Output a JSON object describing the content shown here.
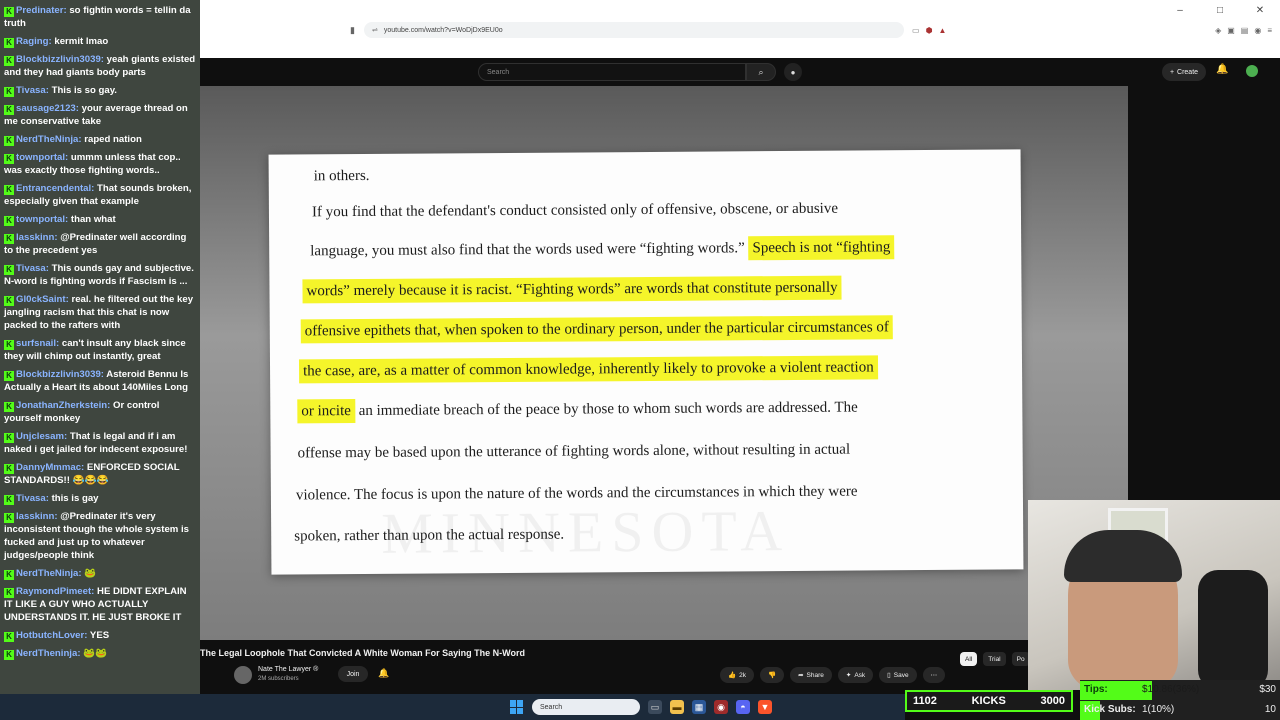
{
  "browser": {
    "url": "youtube.com/watch?v=WoDjDx9EU0o",
    "win_minimize": "–",
    "win_maximize": "□",
    "win_close": "✕"
  },
  "youtube": {
    "search_placeholder": "Search",
    "create_label": "Create",
    "video_title": "The Legal Loophole That Convicted A White Woman For Saying The N-Word",
    "channel_name": "Nate The Lawyer ®",
    "channel_subs": "2M subscribers",
    "join_label": "Join",
    "likes": "2k",
    "share_label": "Share",
    "ask_label": "Ask",
    "save_label": "Save",
    "chips": [
      "All",
      "Trial",
      "Po"
    ]
  },
  "document": {
    "line1": "in others.",
    "line2": "If you find that the defendant's conduct consisted only of offensive, obscene, or abusive",
    "line3a": "language, you must also find that the words used were “fighting words.” ",
    "line3b": "Speech is not “fighting",
    "line4": "words” merely because it is racist. “Fighting words” are words that constitute personally",
    "line5": "offensive epithets that, when spoken to the ordinary person, under the particular circumstances of",
    "line6": "the case, are, as a matter of common knowledge, inherently likely to provoke a violent reaction",
    "line7a": "or incite",
    "line7b": " an immediate breach of the peace by those to whom such words are addressed. The",
    "line8": "offense may be based upon the utterance of fighting words alone, without resulting in actual",
    "line9": "violence. The focus is upon the nature of the words and the circumstances in which they were",
    "line10": "spoken, rather than upon the actual response.",
    "watermark": "MINNESOTA"
  },
  "chat": [
    {
      "user": "Predinater",
      "text": "so fightin words = tellin da truth"
    },
    {
      "user": "Raging",
      "text": "kermit lmao"
    },
    {
      "user": "Blockbizzlivin3039",
      "text": "yeah giants existed and they had giants body parts"
    },
    {
      "user": "Tivasa",
      "text": "This is so gay."
    },
    {
      "user": "sausage2123",
      "text": "your average thread on me conservative take"
    },
    {
      "user": "NerdTheNinja",
      "text": "raped nation"
    },
    {
      "user": "townportal",
      "text": "ummm unless that cop.. was exactly those fighting words.."
    },
    {
      "user": "Entrancendental",
      "text": "That sounds broken, especially given that example"
    },
    {
      "user": "townportal",
      "text": "than what"
    },
    {
      "user": "lasskinn",
      "text": "@Predinater well according to the precedent yes"
    },
    {
      "user": "Tivasa",
      "text": "This ounds gay and subjective. N-word is fighting words if Fascism is ..."
    },
    {
      "user": "Gl0ckSaint",
      "text": "real. he filtered out the key jangling racism that this chat is now packed to the rafters with"
    },
    {
      "user": "surfsnail",
      "text": "can't insult any black since they will chimp out instantly, great"
    },
    {
      "user": "Blockbizzlivin3039",
      "text": "Asteroid Bennu Is Actually a Heart its about 140Miles Long"
    },
    {
      "user": "JonathanZherkstein",
      "text": "Or control yourself monkey"
    },
    {
      "user": "Unjclesam",
      "text": "That is legal and if i am naked i get jailed for indecent exposure!"
    },
    {
      "user": "DannyMmmac",
      "text": "ENFORCED SOCIAL STANDARDS!! 😂😂😂"
    },
    {
      "user": "Tivasa",
      "text": "this is gay"
    },
    {
      "user": "lasskinn",
      "text": "@Predinater it's very inconsistent though the whole system is fucked and just up to whatever judges/people think"
    },
    {
      "user": "NerdTheNinja",
      "text": "🐸"
    },
    {
      "user": "RaymondPimeet",
      "text": "HE DIDNT EXPLAIN IT LIKE A GUY WHO ACTUALLY UNDERSTANDS IT. HE JUST BROKE IT"
    },
    {
      "user": "HotbutchLover",
      "text": "YES"
    },
    {
      "user": "NerdTheninja",
      "text": "🐸🐸"
    }
  ],
  "ticker": {
    "count": "1102",
    "label": "KICKS",
    "target": "3000"
  },
  "goals": {
    "tips_label": "Tips:",
    "tips_value": "$10.86(36%)",
    "tips_target": "$30",
    "tips_progress": 0.36,
    "subs_label": "Kick Subs:",
    "subs_value": "1(10%)",
    "subs_target": "10",
    "subs_progress": 0.1
  },
  "taskbar": {
    "search_placeholder": "Search"
  },
  "colors": {
    "kick_green": "#53fc18",
    "highlight": "#f5f52a",
    "yt_dark": "#0f0f0f"
  }
}
